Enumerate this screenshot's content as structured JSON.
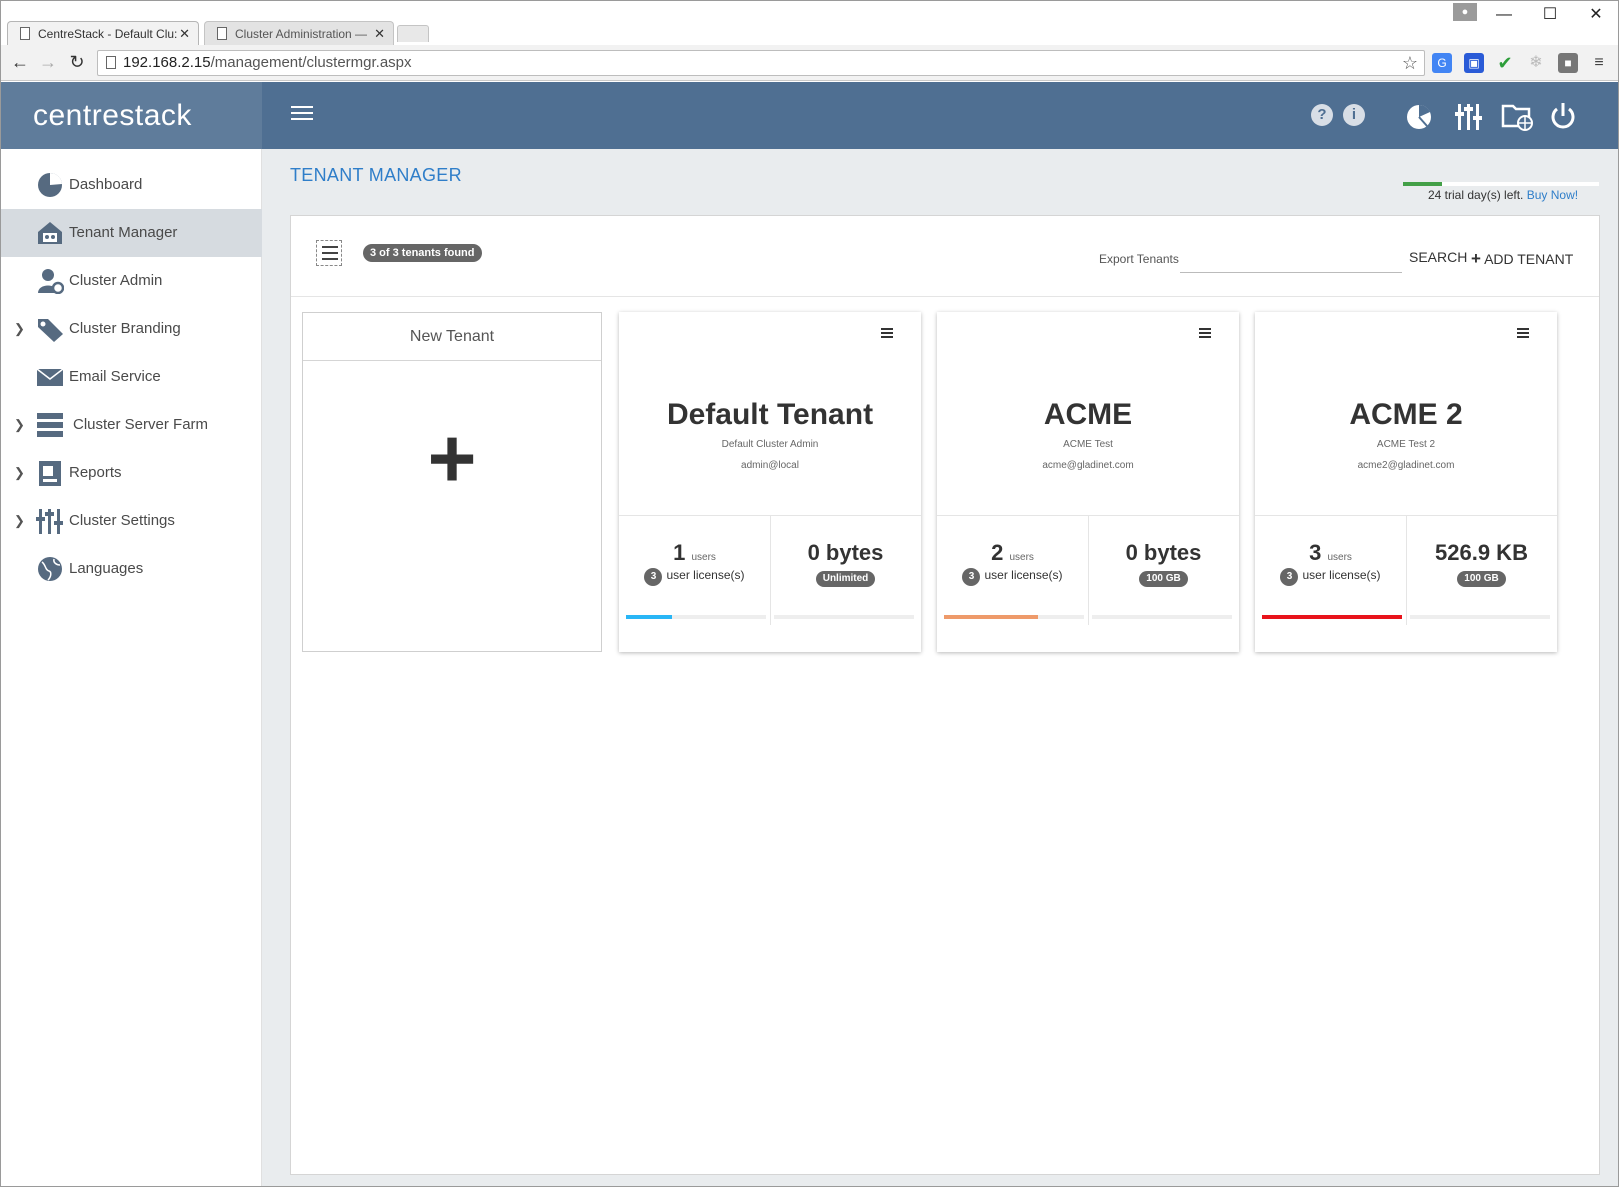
{
  "browser": {
    "tabs": [
      {
        "title": "CentreStack - Default Clu:",
        "active": true
      },
      {
        "title": "Cluster Administration —",
        "active": false
      }
    ],
    "url_host": "192.168.2.15",
    "url_path": "/management/clustermgr.aspx",
    "window_controls": {
      "minimize": "—",
      "maximize": "☐",
      "close": "✕"
    }
  },
  "app": {
    "brand": "centrestack",
    "header_icons": [
      "help-icon",
      "info-icon",
      "dashboard-icon",
      "settings-icon",
      "folder-globe-icon",
      "power-icon"
    ],
    "colors": {
      "header": "#4f6f92",
      "accent": "#2f7ec9",
      "trial": "#43a047"
    }
  },
  "sidebar": {
    "items": [
      {
        "label": "Dashboard",
        "icon": "dashboard-icon",
        "expandable": false
      },
      {
        "label": "Tenant Manager",
        "icon": "tenant-manager-icon",
        "expandable": false,
        "active": true
      },
      {
        "label": "Cluster Admin",
        "icon": "cluster-admin-icon",
        "expandable": false
      },
      {
        "label": "Cluster Branding",
        "icon": "branding-tag-icon",
        "expandable": true
      },
      {
        "label": "Email Service",
        "icon": "envelope-icon",
        "expandable": false
      },
      {
        "label": "Cluster Server Farm",
        "icon": "server-farm-icon",
        "expandable": true
      },
      {
        "label": "Reports",
        "icon": "reports-icon",
        "expandable": true
      },
      {
        "label": "Cluster Settings",
        "icon": "settings-icon",
        "expandable": true
      },
      {
        "label": "Languages",
        "icon": "globe-icon",
        "expandable": false
      }
    ]
  },
  "page": {
    "title": "TENANT MANAGER",
    "trial_text": "24 trial day(s) left.",
    "trial_link": "Buy Now!",
    "trial_progress": 0.2
  },
  "toolbar": {
    "count_badge": "3 of 3 tenants found",
    "export_label": "Export Tenants",
    "search_value": "",
    "search_label": "SEARCH",
    "add_label": "ADD TENANT"
  },
  "new_tenant": {
    "title": "New Tenant",
    "plus": "+"
  },
  "tenants": [
    {
      "name": "Default Tenant",
      "desc": "Default Cluster Admin",
      "email": "admin@local",
      "users": "1",
      "users_unit": "users",
      "licenses": "3",
      "license_label": "user license(s)",
      "storage": "0 bytes",
      "quota": "Unlimited",
      "user_ratio": 0.33,
      "user_bar_color": "#29b6f6",
      "storage_ratio": 0
    },
    {
      "name": "ACME",
      "desc": "ACME Test",
      "email": "acme@gladinet.com",
      "users": "2",
      "users_unit": "users",
      "licenses": "3",
      "license_label": "user license(s)",
      "storage": "0 bytes",
      "quota": "100 GB",
      "user_ratio": 0.67,
      "user_bar_color": "#ee9a6a",
      "storage_ratio": 0
    },
    {
      "name": "ACME 2",
      "desc": "ACME Test 2",
      "email": "acme2@gladinet.com",
      "users": "3",
      "users_unit": "users",
      "licenses": "3",
      "license_label": "user license(s)",
      "storage": "526.9 KB",
      "quota": "100 GB",
      "user_ratio": 1.0,
      "user_bar_color": "#e8131b",
      "storage_ratio": 0
    }
  ]
}
